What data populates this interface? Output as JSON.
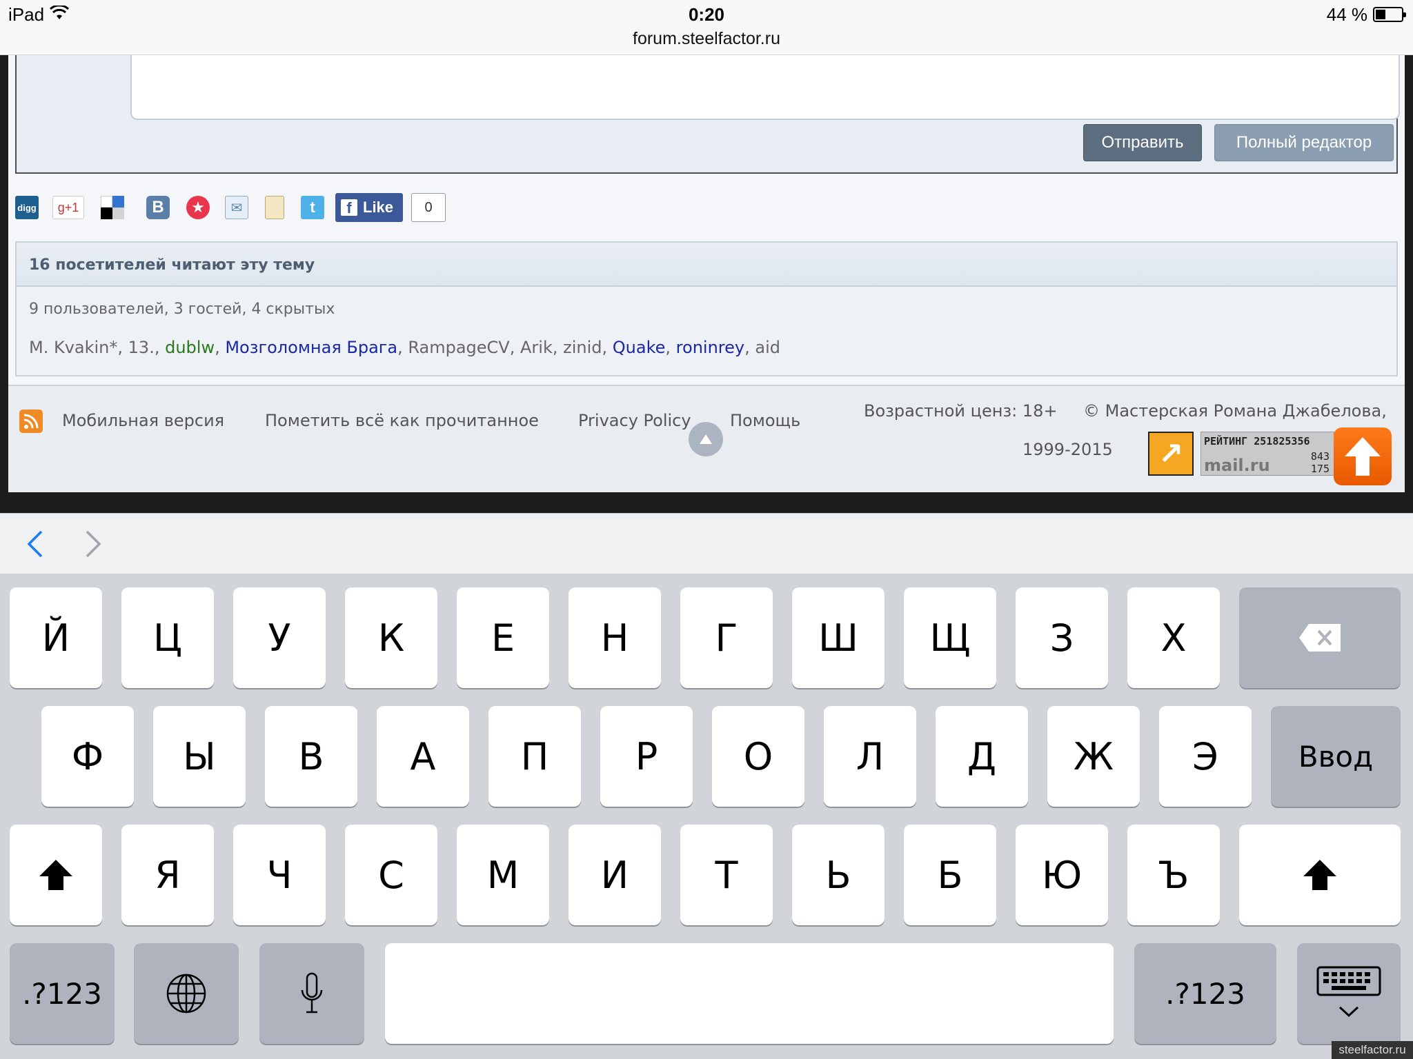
{
  "status_bar": {
    "device": "iPad",
    "time": "0:20",
    "url": "forum.steelfactor.ru",
    "battery_text": "44 %",
    "battery_level": 0.44
  },
  "reply": {
    "send_label": "Отправить",
    "full_editor_label": "Полный редактор"
  },
  "share": {
    "icons": [
      "digg-icon",
      "google-plus-icon",
      "delicious-icon",
      "vkontakte-icon",
      "star-icon",
      "mail-icon",
      "print-icon",
      "twitter-icon"
    ],
    "digg_label": "digg",
    "gplus_label": "g+1",
    "vk_label": "B",
    "fb_label": "Like",
    "fb_count": "0"
  },
  "visitors": {
    "heading": "16 посетителей читают эту тему",
    "summary": "9 пользователей, 3 гостей, 4 скрытых",
    "users": [
      {
        "name": "M. Kvakin*",
        "color": "plain"
      },
      {
        "name": "13.",
        "color": "plain"
      },
      {
        "name": "dublw",
        "color": "green"
      },
      {
        "name": "Мозголомная Брага",
        "color": "blue"
      },
      {
        "name": "RampageCV",
        "color": "plain"
      },
      {
        "name": "Arik",
        "color": "plain"
      },
      {
        "name": "zinid",
        "color": "plain"
      },
      {
        "name": "Quake",
        "color": "blue"
      },
      {
        "name": "roninrey",
        "color": "blue"
      },
      {
        "name": "aid",
        "color": "plain"
      }
    ]
  },
  "footer": {
    "mobile": "Мобильная версия",
    "mark_read": "Пометить всё как прочитанное",
    "privacy": "Privacy Policy",
    "help": "Помощь",
    "age": "Возрастной ценз: 18+",
    "copyright": "© Мастерская Романа Джабелова,",
    "years": "1999-2015",
    "rating_label": "РЕЙТИНГ 251825356",
    "rating_a": "843",
    "rating_b": "175",
    "mail_logo": "mail.ru"
  },
  "keyboard": {
    "row1": [
      "Й",
      "Ц",
      "У",
      "К",
      "Е",
      "Н",
      "Г",
      "Ш",
      "Щ",
      "З",
      "Х"
    ],
    "row2": [
      "Ф",
      "Ы",
      "В",
      "А",
      "П",
      "Р",
      "О",
      "Л",
      "Д",
      "Ж",
      "Э"
    ],
    "row3": [
      "Я",
      "Ч",
      "С",
      "М",
      "И",
      "Т",
      "Ь",
      "Б",
      "Ю",
      "Ъ"
    ],
    "return_label": "Ввод",
    "numbers_label": ".?123"
  },
  "watermark": "steelfactor.ru"
}
